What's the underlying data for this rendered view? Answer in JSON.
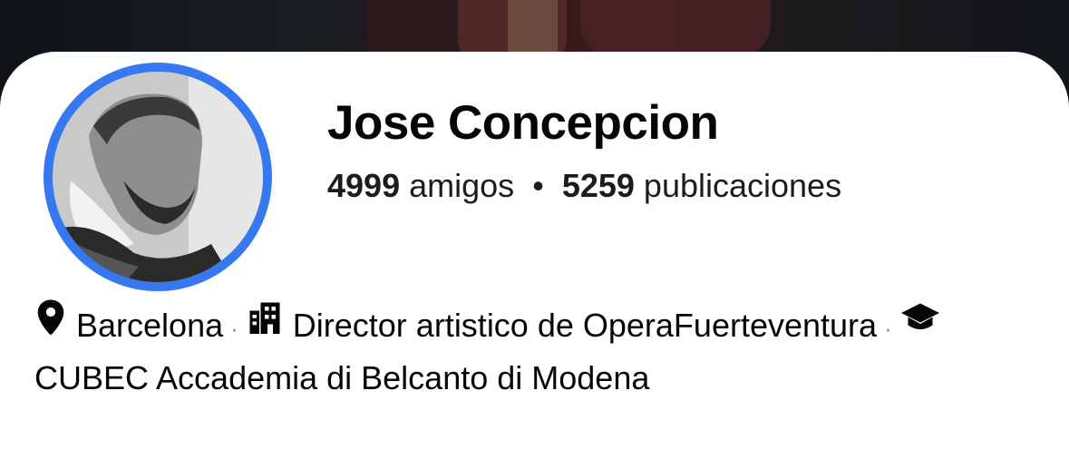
{
  "profile": {
    "name": "Jose Concepcion",
    "friends_count": "4999",
    "friends_label": "amigos",
    "posts_count": "5259",
    "posts_label": "publicaciones",
    "separator": "•",
    "accent_color": "#3578f0"
  },
  "details": [
    {
      "icon": "location-pin-icon",
      "text": "Barcelona"
    },
    {
      "icon": "building-icon",
      "text": "Director artistico de OperaFuerteventura"
    },
    {
      "icon": "graduation-cap-icon",
      "text": "CUBEC Accademia di Belcanto di Modena"
    }
  ],
  "details_separator": "·"
}
